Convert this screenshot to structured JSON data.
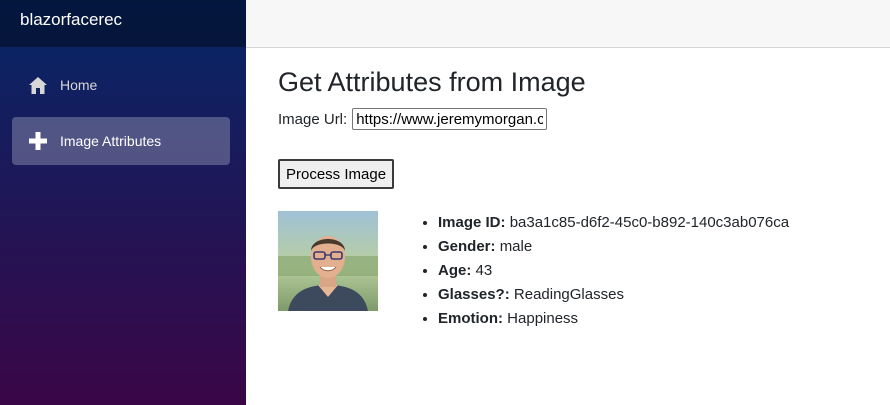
{
  "brand": "blazorfacerec",
  "nav": [
    {
      "label": "Home",
      "icon": "home-icon",
      "active": false
    },
    {
      "label": "Image Attributes",
      "icon": "plus-icon",
      "active": true
    }
  ],
  "page": {
    "title": "Get Attributes from Image",
    "url_label": "Image Url:",
    "url_value": "https://www.jeremymorgan.com",
    "process_button": "Process Image"
  },
  "attributes": [
    {
      "label": "Image ID:",
      "value": "ba3a1c85-d6f2-45c0-b892-140c3ab076ca"
    },
    {
      "label": "Gender:",
      "value": "male"
    },
    {
      "label": "Age:",
      "value": "43"
    },
    {
      "label": "Glasses?:",
      "value": "ReadingGlasses"
    },
    {
      "label": "Emotion:",
      "value": "Happiness"
    }
  ],
  "colors": {
    "sidebar_top": "#052767",
    "sidebar_bottom": "#3a0647",
    "active_item_bg": "rgba(255,255,255,0.25)"
  }
}
